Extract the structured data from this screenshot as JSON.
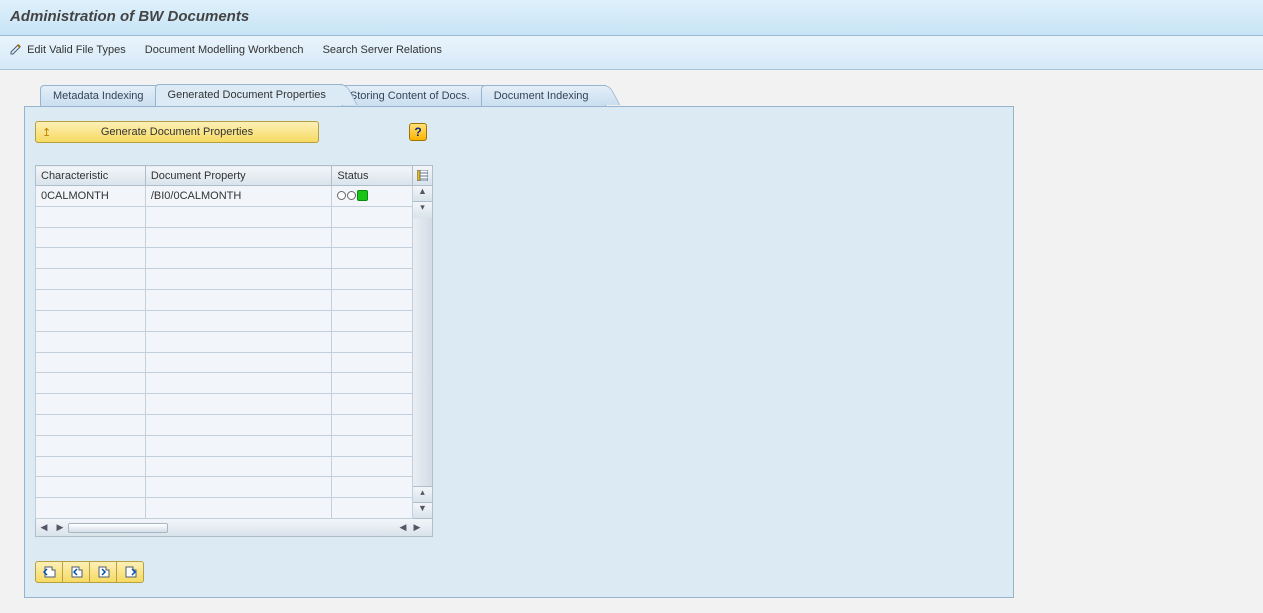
{
  "header": {
    "title": "Administration of BW Documents"
  },
  "toolbar": {
    "edit_types": "Edit Valid File Types",
    "workbench": "Document Modelling Workbench",
    "search_rel": "Search Server Relations"
  },
  "tabs": [
    {
      "label": "Metadata Indexing",
      "active": false
    },
    {
      "label": "Generated Document Properties",
      "active": true
    },
    {
      "label": "Storing Content of Docs.",
      "active": false
    },
    {
      "label": "Document Indexing",
      "active": false
    }
  ],
  "action_button": "Generate Document Properties",
  "grid": {
    "columns": {
      "characteristic": "Characteristic",
      "property": "Document Property",
      "status": "Status"
    },
    "rows": [
      {
        "characteristic": "0CALMONTH",
        "property": "/BI0/0CALMONTH",
        "status": "green"
      }
    ],
    "blank_rows": 15
  },
  "bottom_icons": [
    "page-first",
    "page-prev",
    "page-next",
    "page-last"
  ]
}
